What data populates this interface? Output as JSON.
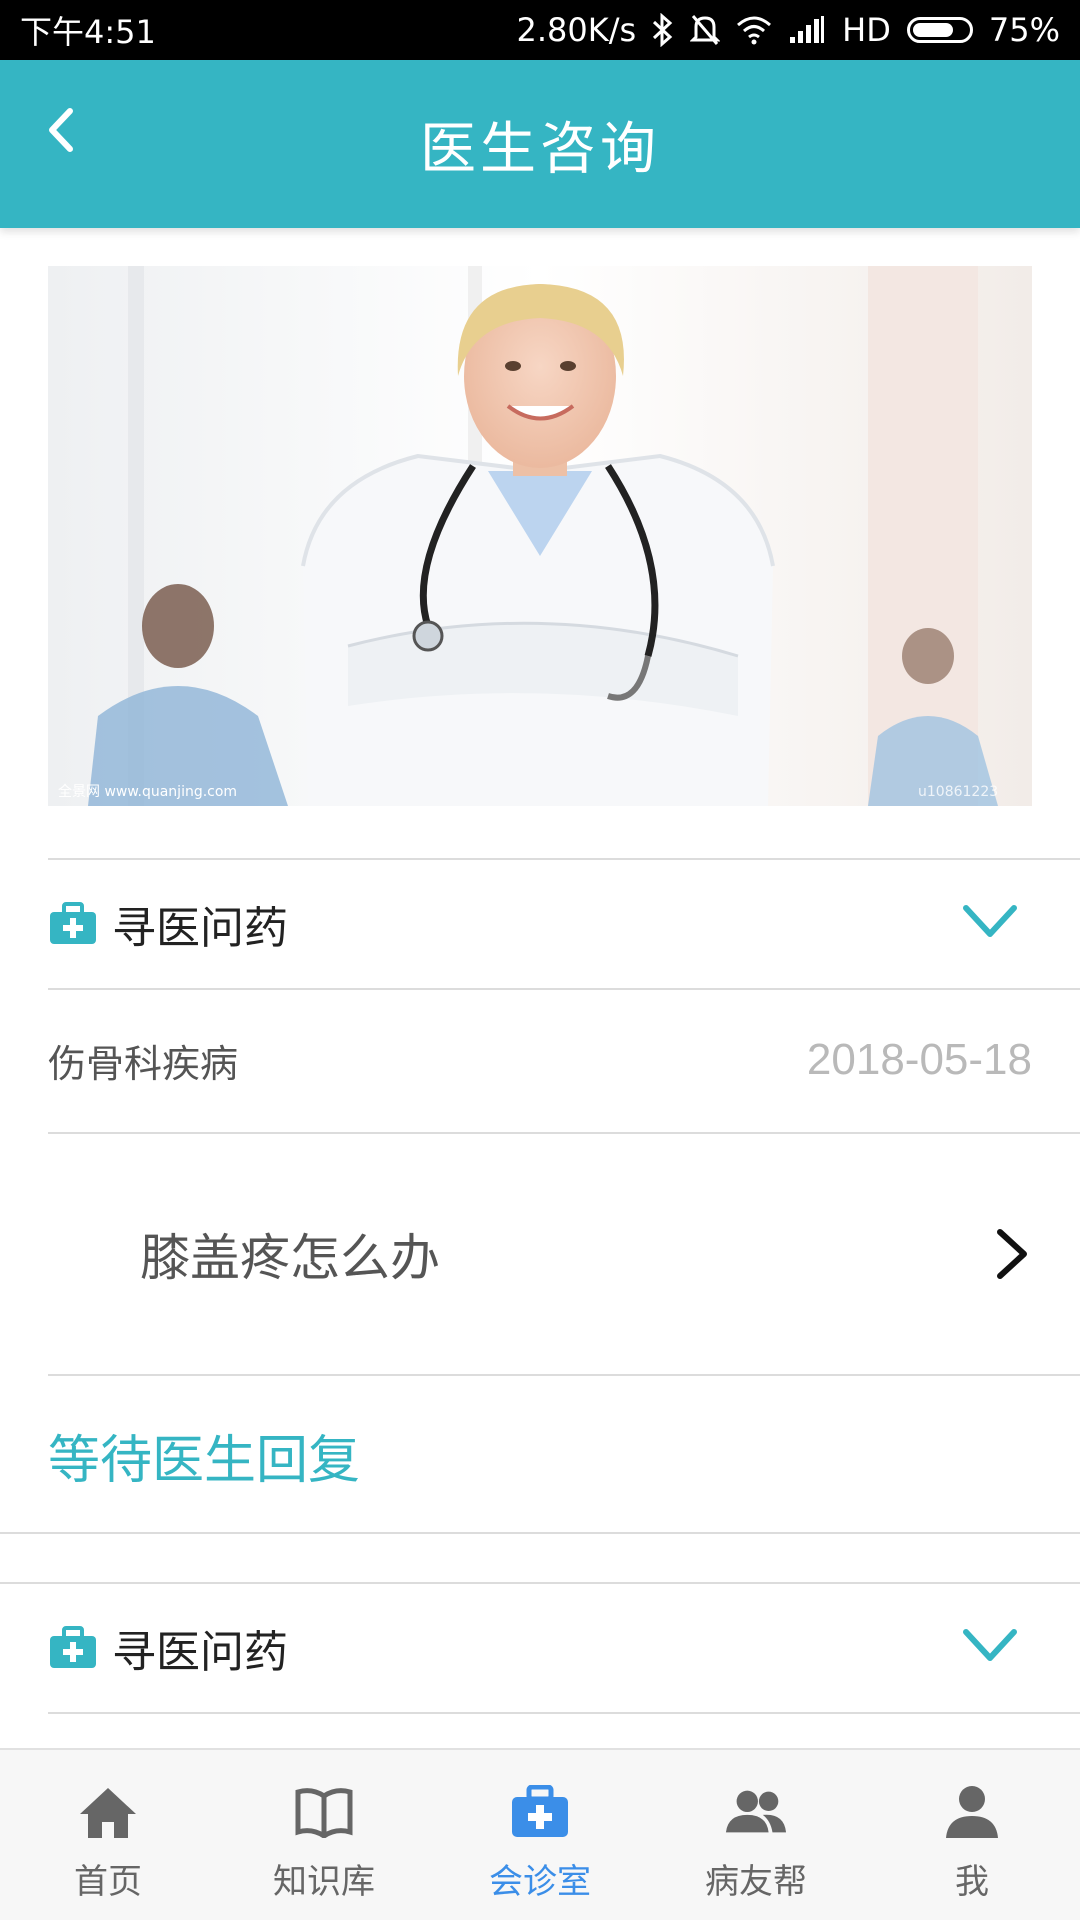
{
  "status_bar": {
    "time": "下午4:51",
    "speed": "2.80K/s",
    "network": "HD",
    "battery_percent": "75%",
    "battery_level": 0.75
  },
  "app_bar": {
    "title": "医生咨询"
  },
  "hero": {
    "watermark_left": "全景网 www.quanjing.com",
    "watermark_right": "u10861223"
  },
  "sections": [
    {
      "title": "寻医问药",
      "category": "伤骨科疾病",
      "date": "2018-05-18",
      "question": "膝盖疼怎么办",
      "status": "等待医生回复"
    },
    {
      "title": "寻医问药"
    }
  ],
  "colors": {
    "accent": "#35b5c3",
    "active_nav": "#3b8ee8"
  },
  "bottom_nav": {
    "items": [
      {
        "label": "首页",
        "icon": "home-icon"
      },
      {
        "label": "知识库",
        "icon": "book-icon"
      },
      {
        "label": "会诊室",
        "icon": "medical-kit-icon",
        "active": true
      },
      {
        "label": "病友帮",
        "icon": "group-icon"
      },
      {
        "label": "我",
        "icon": "user-icon"
      }
    ]
  }
}
